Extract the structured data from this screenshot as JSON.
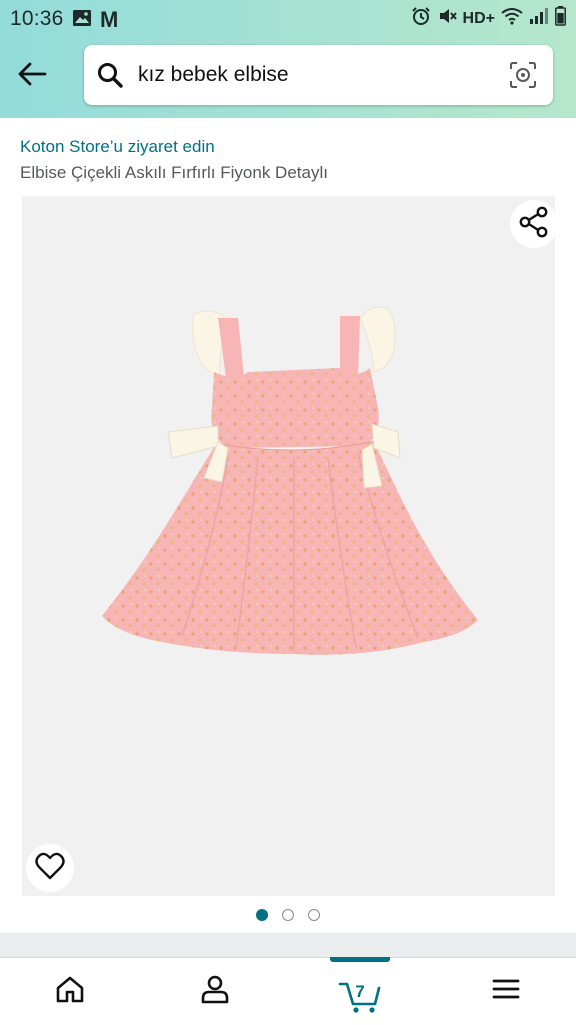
{
  "status_bar": {
    "time": "10:36",
    "left_icons": [
      "image-icon",
      "gmail-icon"
    ],
    "m_label": "M",
    "network_label": "HD+",
    "right_icons": [
      "alarm-icon",
      "mute-icon",
      "wifi-icon",
      "signal-icon",
      "battery-icon"
    ]
  },
  "header": {
    "back_icon": "back-arrow-icon",
    "search": {
      "value": "kız bebek elbise",
      "search_icon": "search-icon",
      "camera_icon": "camera-lens-icon"
    }
  },
  "product": {
    "store_link": "Koton Store’u ziyaret edin",
    "title": "Elbise Çiçekli Askılı Fırfırlı Fiyonk Detaylı",
    "image": {
      "description_icon": "product-image",
      "share_icon": "share-icon",
      "wishlist_icon": "heart-icon"
    },
    "carousel": {
      "count": 3,
      "active_index": 0
    }
  },
  "bottom_nav": {
    "items": [
      {
        "icon": "home-icon"
      },
      {
        "icon": "account-icon"
      },
      {
        "icon": "cart-icon",
        "count": "7"
      },
      {
        "icon": "menu-icon"
      }
    ]
  },
  "colors": {
    "header_gradient_start": "#93dcdb",
    "header_gradient_end": "#b6e7cd",
    "link": "#007185",
    "accent": "#007185",
    "dress_pink": "#f7b5b6",
    "dress_trim": "#fbf5e6"
  }
}
